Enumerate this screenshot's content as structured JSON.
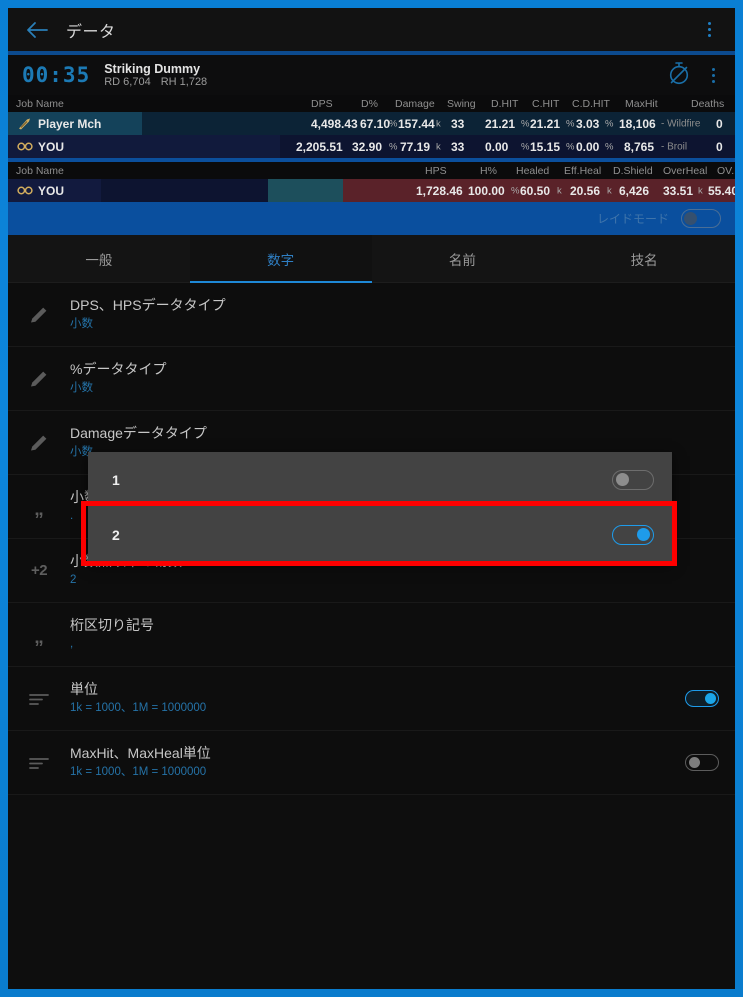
{
  "titlebar": {
    "back_icon": "arrow-left-icon",
    "title": "データ",
    "menu_icon": "kebab-menu-icon"
  },
  "meter": {
    "timer": "00:35",
    "encounter_name": "Striking Dummy",
    "rd_label": "RD 6,704",
    "rh_label": "RH 1,728",
    "stopwatch_icon": "stopwatch-off-icon",
    "menu_icon": "kebab-menu-icon",
    "damage_table": {
      "headers": [
        "Job Name",
        "DPS",
        "D%",
        "Damage",
        "Swing",
        "D.HIT",
        "C.HIT",
        "C.D.HIT",
        "MaxHit",
        "Deaths"
      ],
      "rows": [
        {
          "job_icon": "machinist-job-icon",
          "name": "Player Mch",
          "dps": "4,498.43",
          "dpct": "67.10",
          "dpct_unit": "%",
          "damage": "157.44",
          "damage_unit": "k",
          "swing": "33",
          "dhit": "21.21",
          "dhit_unit": "%",
          "chit": "21.21",
          "chit_unit": "%",
          "cdhit": "3.03",
          "cdhit_unit": "%",
          "maxhit": "18,106",
          "maxhit_skill": "- Wildfire",
          "deaths": "0"
        },
        {
          "job_icon": "astrologian-job-icon",
          "name": "YOU",
          "dps": "2,205.51",
          "dpct": "32.90",
          "dpct_unit": "%",
          "damage": "77.19",
          "damage_unit": "k",
          "swing": "33",
          "dhit": "0.00",
          "dhit_unit": "%",
          "chit": "15.15",
          "chit_unit": "%",
          "cdhit": "0.00",
          "cdhit_unit": "%",
          "maxhit": "8,765",
          "maxhit_skill": "- Broil",
          "deaths": "0"
        }
      ]
    },
    "heal_table": {
      "headers": [
        "Job Name",
        "HPS",
        "H%",
        "Healed",
        "Eff.Heal",
        "D.Shield",
        "OverHeal",
        "OV.H"
      ],
      "rows": [
        {
          "job_icon": "astrologian-job-icon",
          "name": "YOU",
          "hps": "1,728.46",
          "hpct": "100.00",
          "hpct_unit": "%",
          "healed": "60.50",
          "healed_unit": "k",
          "effheal": "20.56",
          "effheal_unit": "k",
          "dshield": "6,426",
          "overheal": "33.51",
          "overheal_unit": "k",
          "ovh": "55.40",
          "ovh_unit": "%"
        }
      ]
    },
    "raid_mode_label": "レイドモード",
    "raid_mode_on": false
  },
  "tabs": [
    {
      "label": "一般",
      "active": false
    },
    {
      "label": "数字",
      "active": true
    },
    {
      "label": "名前",
      "active": false
    },
    {
      "label": "技名",
      "active": false
    }
  ],
  "settings": [
    {
      "icon": "pencil-icon",
      "title": "DPS、HPSデータタイプ",
      "sub": "小数",
      "control": "none"
    },
    {
      "icon": "pencil-icon",
      "title": "%データタイプ",
      "sub": "小数",
      "control": "none"
    },
    {
      "icon": "pencil-icon",
      "title": "Damageデータタイプ",
      "sub": "小数",
      "control": "none"
    },
    {
      "icon": "quote-icon",
      "title": "小数点記号",
      "sub": ".",
      "control": "none"
    },
    {
      "icon": "plus-two-icon",
      "title": "小数点以下の桁数",
      "sub": "2",
      "control": "none"
    },
    {
      "icon": "quote-icon",
      "title": "桁区切り記号",
      "sub": ",",
      "control": "none"
    },
    {
      "icon": "lines-icon",
      "title": "単位",
      "sub": "1k = 1000、1M = 1000000",
      "control": "toggle",
      "toggle_on": true
    },
    {
      "icon": "lines-icon",
      "title": "MaxHit、MaxHeal単位",
      "sub": "1k = 1000、1M = 1000000",
      "control": "toggle",
      "toggle_on": false
    }
  ],
  "dropdown": {
    "options": [
      {
        "label": "1",
        "selected": false
      },
      {
        "label": "2",
        "selected": true
      }
    ]
  },
  "colors": {
    "window_border": "#0b84d9",
    "accent": "#1e9bea",
    "highlight_box": "#fe0000",
    "tab_active": "#2f7fc4",
    "sub_text": "#2573a8"
  }
}
